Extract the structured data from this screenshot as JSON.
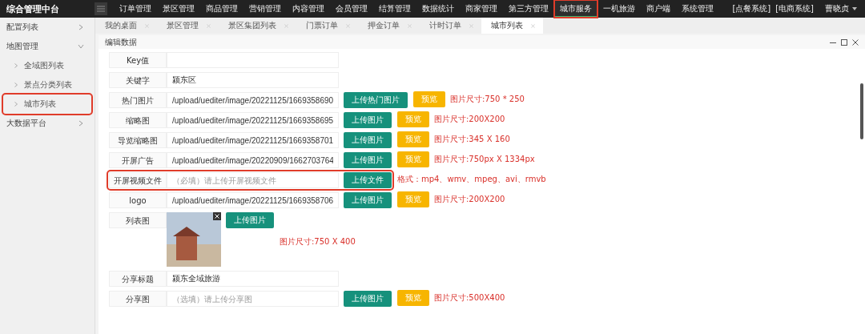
{
  "app_title": "综合管理中台",
  "top_nav": [
    {
      "label": "订单管理",
      "selected": false,
      "highlighted": false
    },
    {
      "label": "景区管理",
      "selected": false,
      "highlighted": false
    },
    {
      "label": "商品管理",
      "selected": false,
      "highlighted": false
    },
    {
      "label": "营销管理",
      "selected": false,
      "highlighted": false
    },
    {
      "label": "内容管理",
      "selected": false,
      "highlighted": false
    },
    {
      "label": "会员管理",
      "selected": false,
      "highlighted": false
    },
    {
      "label": "结算管理",
      "selected": false,
      "highlighted": false
    },
    {
      "label": "数据统计",
      "selected": false,
      "highlighted": false
    },
    {
      "label": "商家管理",
      "selected": false,
      "highlighted": false
    },
    {
      "label": "第三方管理",
      "selected": false,
      "highlighted": false
    },
    {
      "label": "城市服务",
      "selected": true,
      "highlighted": true
    },
    {
      "label": "一机旅游",
      "selected": false,
      "highlighted": false
    },
    {
      "label": "商户端",
      "selected": false,
      "highlighted": false
    },
    {
      "label": "系统管理",
      "selected": false,
      "highlighted": false
    }
  ],
  "system_links": [
    "[点餐系统]",
    "[电商系统]"
  ],
  "user": "曹晓贞",
  "sidebar": [
    {
      "label": "配置列表",
      "expanded": false
    },
    {
      "label": "地图管理",
      "expanded": true,
      "children": [
        {
          "label": "全域图列表",
          "highlighted": false
        },
        {
          "label": "景点分类列表",
          "highlighted": false
        },
        {
          "label": "城市列表",
          "highlighted": true
        }
      ]
    },
    {
      "label": "大数据平台",
      "expanded": false
    }
  ],
  "tabs": [
    {
      "label": "我的桌面",
      "selected": false
    },
    {
      "label": "景区管理",
      "selected": false
    },
    {
      "label": "景区集团列表",
      "selected": false
    },
    {
      "label": "门票订单",
      "selected": false
    },
    {
      "label": "押金订单",
      "selected": false
    },
    {
      "label": "计时订单",
      "selected": false
    },
    {
      "label": "城市列表",
      "selected": true
    }
  ],
  "dialog": {
    "title": "编辑数据",
    "rows": [
      {
        "kind": "text",
        "label": "Key值",
        "highlighted": false
      },
      {
        "kind": "text",
        "label": "关键字",
        "value": "颍东区",
        "highlighted": false
      },
      {
        "kind": "upload",
        "label": "热门图片",
        "value": "/upload/uediter/image/20221125/1669358690",
        "upload": "上传热门图片",
        "preview": "预览",
        "note": "图片尺寸:750 * 250",
        "highlighted": false
      },
      {
        "kind": "upload",
        "label": "缩略图",
        "value": "/upload/uediter/image/20221125/1669358695",
        "upload": "上传图片",
        "preview": "预览",
        "note": "图片尺寸:200X200",
        "highlighted": false
      },
      {
        "kind": "upload",
        "label": "导览缩略图",
        "value": "/upload/uediter/image/20221125/1669358701",
        "upload": "上传图片",
        "preview": "预览",
        "note": "图片尺寸:345 X 160",
        "highlighted": false
      },
      {
        "kind": "upload",
        "label": "开屏广告",
        "value": "/upload/uediter/image/20220909/1662703764",
        "upload": "上传图片",
        "preview": "预览",
        "note": "图片尺寸:750px X 1334px",
        "highlighted": false
      },
      {
        "kind": "upload",
        "label": "开屏视频文件",
        "placeholder": "（必填）请上传开屏视频文件",
        "upload": "上传文件",
        "note": "格式：mp4、wmv、mpeg、avi、rmvb",
        "highlighted": true
      },
      {
        "kind": "upload",
        "label": "logo",
        "value": "/upload/uediter/image/20221125/1669358706",
        "upload": "上传图片",
        "preview": "预览",
        "note": "图片尺寸:200X200",
        "highlighted": false
      },
      {
        "kind": "image",
        "label": "列表图",
        "upload": "上传图片",
        "note": "图片尺寸:750 X 400",
        "highlighted": false
      },
      {
        "kind": "text",
        "label": "分享标题",
        "value": "颍东全域旅游",
        "highlighted": false
      },
      {
        "kind": "upload",
        "label": "分享图",
        "placeholder": "（选填）请上传分享图",
        "upload": "上传图片",
        "preview": "预览",
        "note": "图片尺寸:500X400",
        "highlighted": false
      }
    ]
  }
}
